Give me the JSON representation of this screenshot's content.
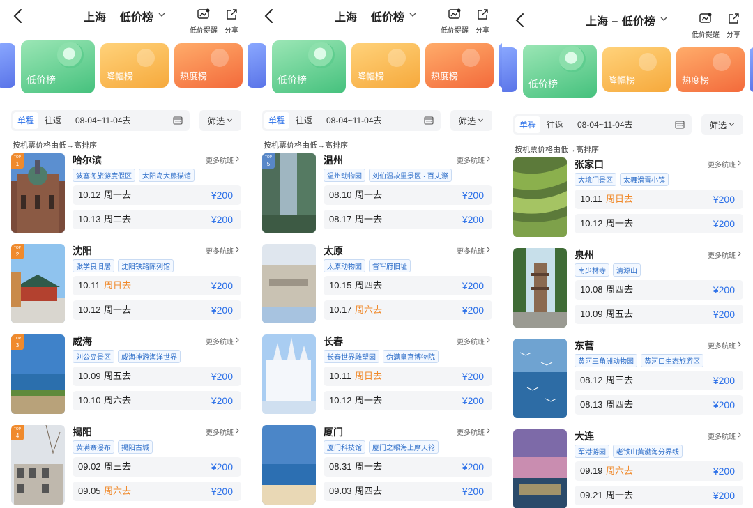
{
  "panels": [
    {
      "title": "上海",
      "list_name": "低价榜",
      "dash": "–",
      "actions": {
        "alert": "低价提醒",
        "share": "分享"
      },
      "categories": {
        "low": "低价榜",
        "drop": "降幅榜",
        "hot": "热度榜"
      },
      "tabs": {
        "one_way": "单程",
        "round": "往返"
      },
      "date_range": "08-04~11-04去",
      "filter": "筛选",
      "sort_hint": "按机票价格由低→高排序",
      "more": "更多航班",
      "cards": [
        {
          "top_label": "TOP",
          "rank": "1",
          "city": "哈尔滨",
          "tags": [
            "波塞冬旅游度假区",
            "太阳岛大熊猫馆"
          ],
          "flights": [
            {
              "date": "10.12",
              "weekday": "周一去",
              "price": "¥200"
            },
            {
              "date": "10.13",
              "weekday": "周二去",
              "price": "¥200"
            }
          ]
        },
        {
          "top_label": "TOP",
          "rank": "2",
          "city": "沈阳",
          "tags": [
            "张学良旧居",
            "沈阳铁路陈列馆"
          ],
          "flights": [
            {
              "date": "10.11",
              "weekday": "周日去",
              "price": "¥200",
              "weekend": true
            },
            {
              "date": "10.12",
              "weekday": "周一去",
              "price": "¥200"
            }
          ]
        },
        {
          "top_label": "TOP",
          "rank": "3",
          "city": "威海",
          "tags": [
            "刘公岛景区",
            "威海神游海洋世界"
          ],
          "flights": [
            {
              "date": "10.09",
              "weekday": "周五去",
              "price": "¥200"
            },
            {
              "date": "10.10",
              "weekday": "周六去",
              "price": "¥200"
            }
          ]
        },
        {
          "top_label": "TOP",
          "rank": "4",
          "city": "揭阳",
          "tags": [
            "黄满寨瀑布",
            "揭阳古城"
          ],
          "flights": [
            {
              "date": "09.02",
              "weekday": "周三去",
              "price": "¥200"
            },
            {
              "date": "09.05",
              "weekday": "周六去",
              "price": "¥200",
              "weekend": true
            }
          ]
        }
      ]
    },
    {
      "title": "上海",
      "list_name": "低价榜",
      "dash": "–",
      "actions": {
        "alert": "低价提醒",
        "share": "分享"
      },
      "categories": {
        "low": "低价榜",
        "drop": "降幅榜",
        "hot": "热度榜"
      },
      "tabs": {
        "one_way": "单程",
        "round": "往返"
      },
      "date_range": "08-04~11-04去",
      "filter": "筛选",
      "sort_hint": "按机票价格由低→高排序",
      "more": "更多航班",
      "cards": [
        {
          "top_label": "TOP",
          "rank": "5",
          "city": "温州",
          "tags": [
            "温州动物园",
            "刘伯温故里景区 · 百丈漈"
          ],
          "flights": [
            {
              "date": "08.10",
              "weekday": "周一去",
              "price": "¥200"
            },
            {
              "date": "08.17",
              "weekday": "周一去",
              "price": "¥200"
            }
          ]
        },
        {
          "top_label": "",
          "rank": "",
          "city": "太原",
          "tags": [
            "太原动物园",
            "督军府旧址"
          ],
          "flights": [
            {
              "date": "10.15",
              "weekday": "周四去",
              "price": "¥200"
            },
            {
              "date": "10.17",
              "weekday": "周六去",
              "price": "¥200",
              "weekend": true
            }
          ]
        },
        {
          "top_label": "",
          "rank": "",
          "city": "长春",
          "tags": [
            "长春世界雕塑园",
            "伪满皇宫博物院"
          ],
          "flights": [
            {
              "date": "10.11",
              "weekday": "周日去",
              "price": "¥200",
              "weekend": true
            },
            {
              "date": "10.12",
              "weekday": "周一去",
              "price": "¥200"
            }
          ]
        },
        {
          "top_label": "",
          "rank": "",
          "city": "厦门",
          "tags": [
            "厦门科技馆",
            "厦门之眼海上摩天轮"
          ],
          "flights": [
            {
              "date": "08.31",
              "weekday": "周一去",
              "price": "¥200"
            },
            {
              "date": "09.03",
              "weekday": "周四去",
              "price": "¥200"
            }
          ]
        }
      ]
    },
    {
      "title": "上海",
      "list_name": "低价榜",
      "dash": "–",
      "actions": {
        "alert": "低价提醒",
        "share": "分享"
      },
      "categories": {
        "low": "低价榜",
        "drop": "降幅榜",
        "hot": "热度榜"
      },
      "tabs": {
        "one_way": "单程",
        "round": "往返"
      },
      "date_range": "08-04~11-04去",
      "filter": "筛选",
      "sort_hint": "按机票价格由低→高排序",
      "more": "更多航班",
      "cards": [
        {
          "top_label": "",
          "rank": "",
          "city": "张家口",
          "tags": [
            "大境门景区",
            "太舞滑雪小镇"
          ],
          "flights": [
            {
              "date": "10.11",
              "weekday": "周日去",
              "price": "¥200",
              "weekend": true
            },
            {
              "date": "10.12",
              "weekday": "周一去",
              "price": "¥200"
            }
          ]
        },
        {
          "top_label": "",
          "rank": "",
          "city": "泉州",
          "tags": [
            "南少林寺",
            "清源山"
          ],
          "flights": [
            {
              "date": "10.08",
              "weekday": "周四去",
              "price": "¥200"
            },
            {
              "date": "10.09",
              "weekday": "周五去",
              "price": "¥200"
            }
          ]
        },
        {
          "top_label": "",
          "rank": "",
          "city": "东营",
          "tags": [
            "黄河三角洲动物园",
            "黄河口生态旅游区"
          ],
          "flights": [
            {
              "date": "08.12",
              "weekday": "周三去",
              "price": "¥200"
            },
            {
              "date": "08.13",
              "weekday": "周四去",
              "price": "¥200"
            }
          ]
        },
        {
          "top_label": "",
          "rank": "",
          "city": "大连",
          "tags": [
            "军港游园",
            "老铁山黄渤海分界线"
          ],
          "flights": [
            {
              "date": "09.19",
              "weekday": "周六去",
              "price": "¥200",
              "weekend": true
            },
            {
              "date": "09.21",
              "weekday": "周一去",
              "price": "¥200"
            }
          ]
        }
      ]
    }
  ],
  "colors": {
    "accent": "#2a6fe8",
    "weekend": "#f08a2c",
    "tag": "#2b6cc8",
    "badge": "#f08a2c"
  },
  "icons": {
    "back": "chevron-left-icon",
    "alert": "price-alert-icon",
    "share": "share-icon",
    "calendar": "calendar-icon",
    "more": "chevron-right-icon"
  }
}
